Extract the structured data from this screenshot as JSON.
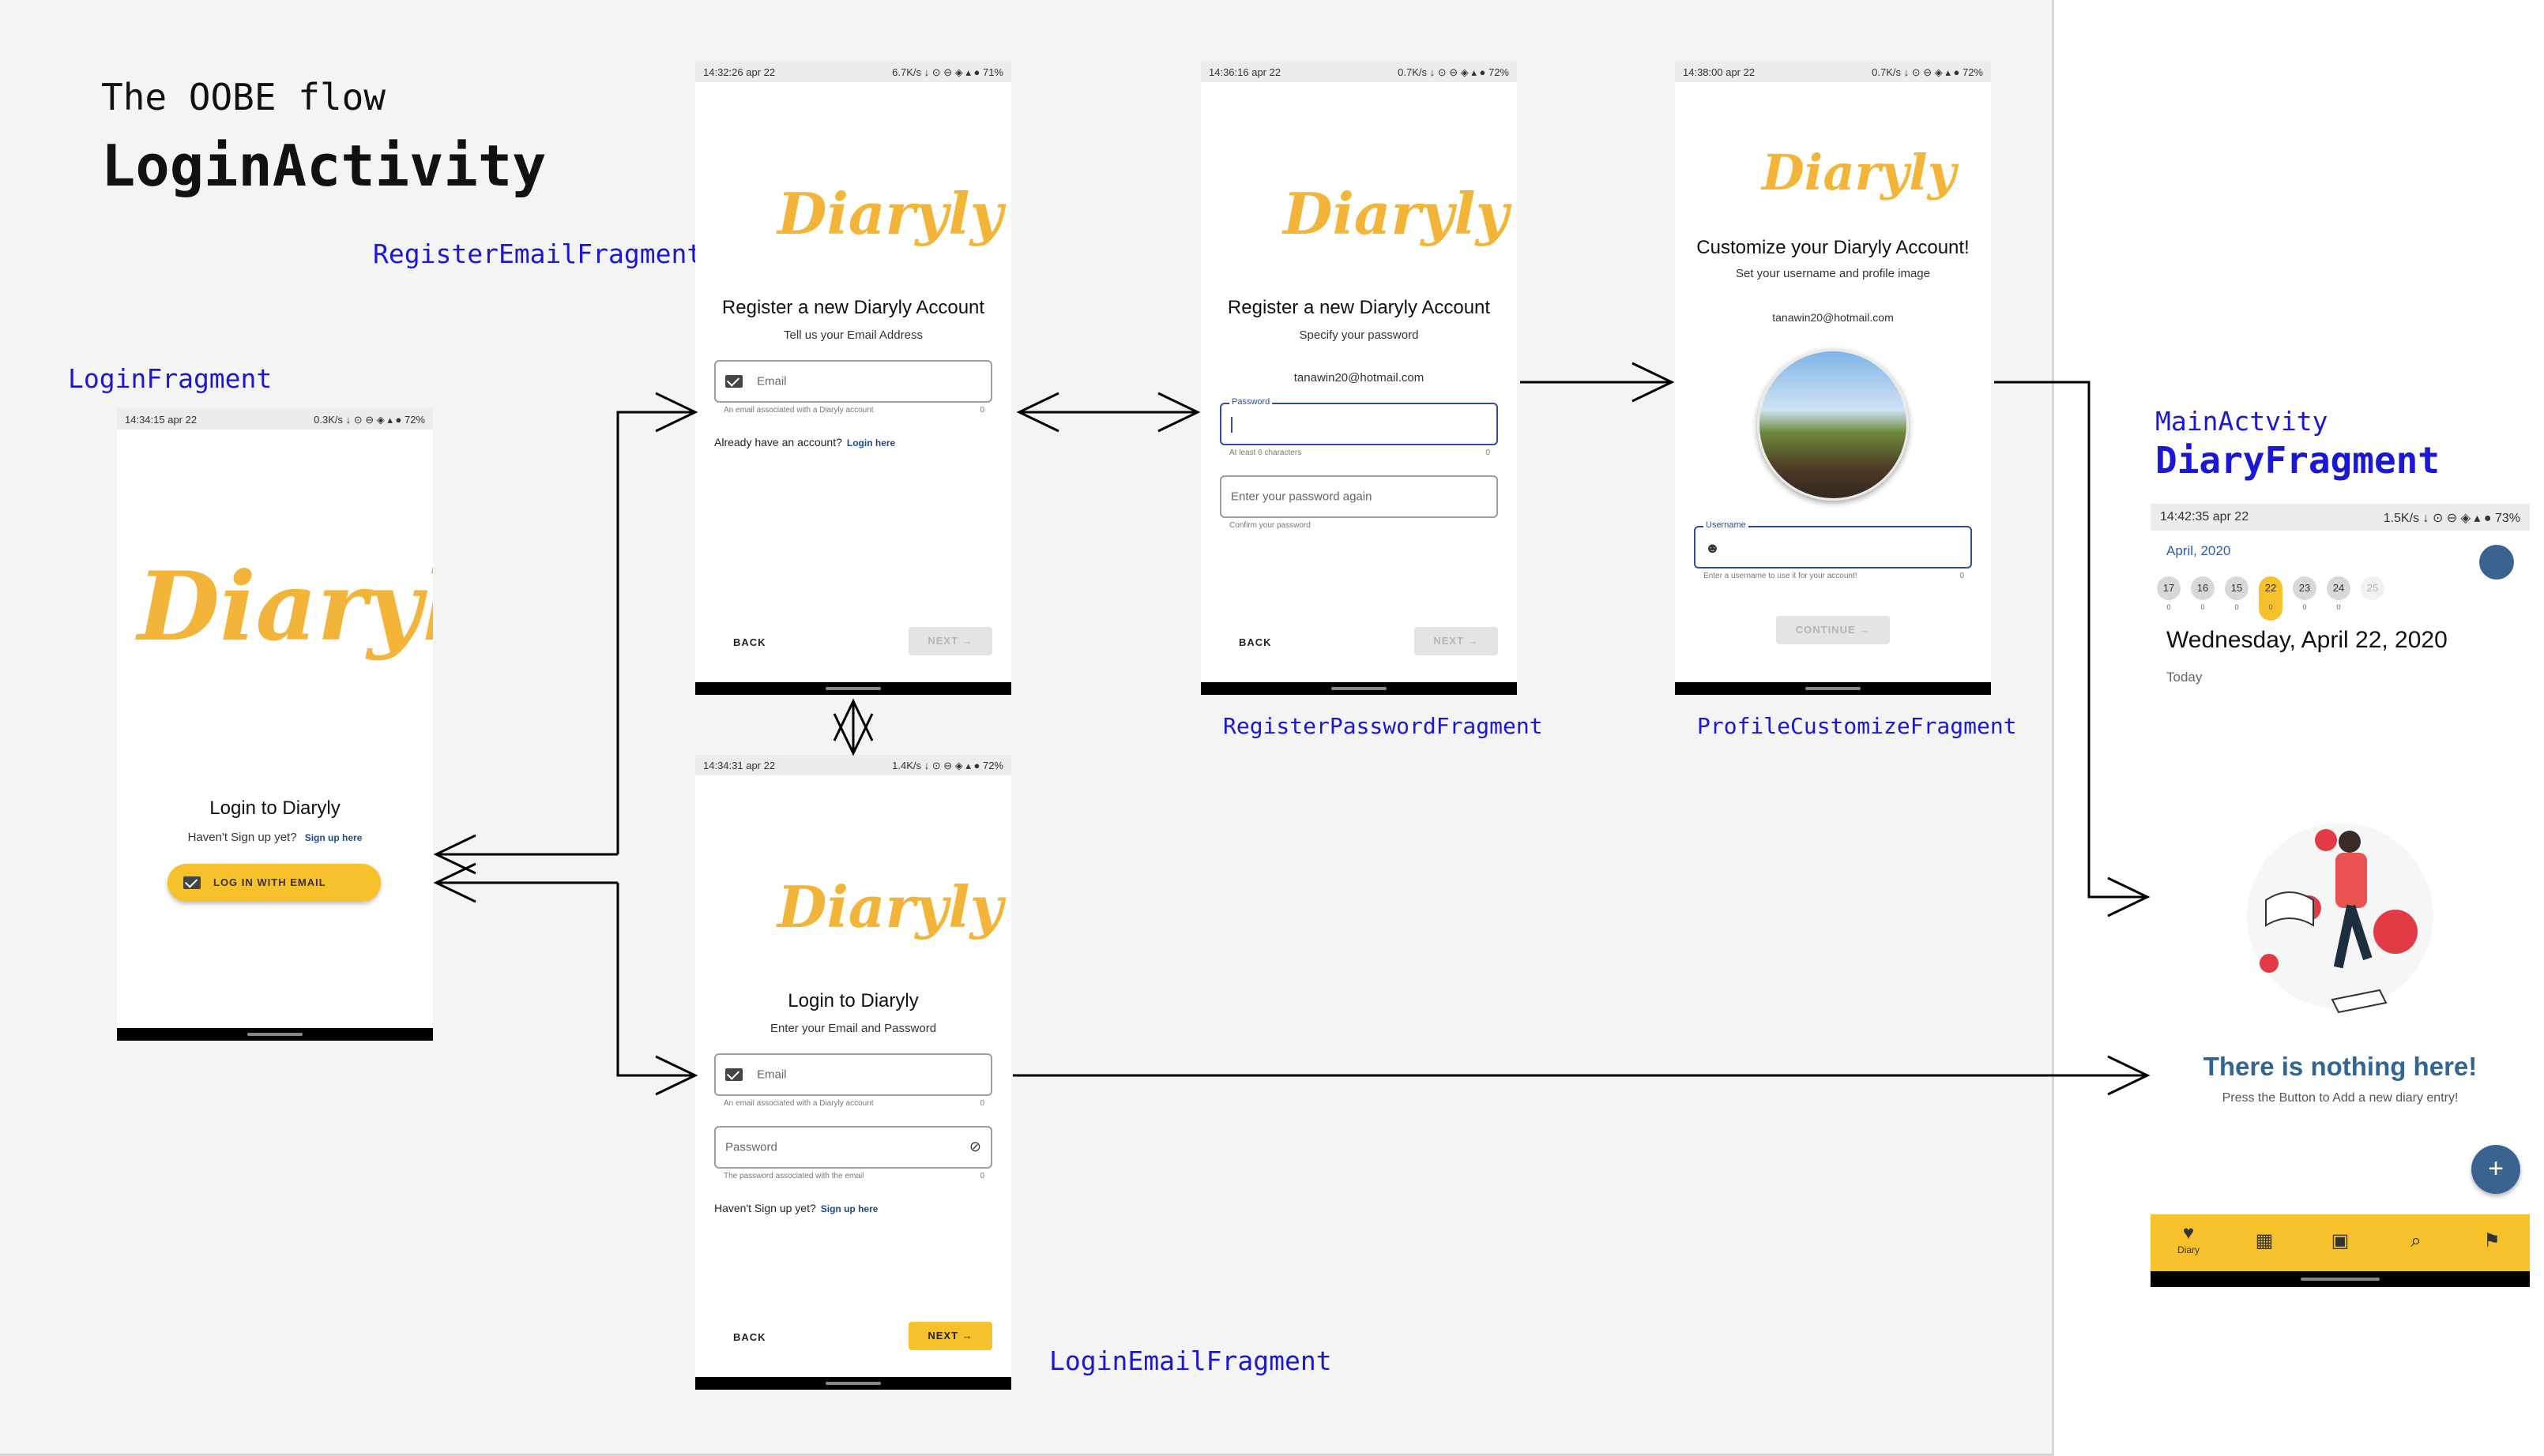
{
  "header": {
    "subtitle": "The OOBE flow",
    "title": "LoginActivity"
  },
  "labels": {
    "login_fragment": "LoginFragment",
    "register_email_fragment": "RegisterEmailFragment",
    "register_password_fragment": "RegisterPasswordFragment",
    "profile_customize_fragment": "ProfileCustomizeFragment",
    "login_email_fragment": "LoginEmailFragment",
    "main_activity": "MainActvity",
    "diary_fragment": "DiaryFragment"
  },
  "brand": {
    "logo_text": "Diaryly",
    "accent": "#f7c12b",
    "link": "#1d4a8a",
    "label_blue": "#1a17d6"
  },
  "screens": {
    "login": {
      "status_time": "14:34:15 apr 22",
      "status_right": "0.3K/s ↓ ⊙ ⊖ ◈ ▴ ● 72%",
      "title": "Login to Diaryly",
      "prompt": "Haven't Sign up yet?",
      "link": "Sign up here",
      "button": "LOG IN WITH EMAIL"
    },
    "register_email": {
      "status_time": "14:32:26 apr 22",
      "status_right": "6.7K/s ↓ ⊙ ⊖ ◈ ▴ ● 71%",
      "title": "Register a new Diaryly Account",
      "subtitle": "Tell us your Email Address",
      "email_placeholder": "Email",
      "email_helper": "An email associated with a Diaryly account",
      "counter": "0",
      "prompt": "Already have an account?",
      "link": "Login here",
      "back": "BACK",
      "next": "NEXT"
    },
    "register_password": {
      "status_time": "14:36:16 apr 22",
      "status_right": "0.7K/s ↓ ⊙ ⊖ ◈ ▴ ● 72%",
      "title": "Register a new Diaryly Account",
      "subtitle": "Specify your password",
      "email": "tanawin20@hotmail.com",
      "password_label": "Password",
      "password_helper": "At least 6 characters",
      "counter": "0",
      "confirm_placeholder": "Enter your password again",
      "confirm_helper": "Confirm your password",
      "back": "BACK",
      "next": "NEXT"
    },
    "profile": {
      "status_time": "14:38:00 apr 22",
      "status_right": "0.7K/s ↓ ⊙ ⊖ ◈ ▴ ● 72%",
      "title": "Customize your Diaryly Account!",
      "subtitle": "Set your username and profile image",
      "email": "tanawin20@hotmail.com",
      "username_label": "Username",
      "username_helper": "Enter a username to use it for your account!",
      "counter": "0",
      "continue": "CONTINUE"
    },
    "login_email": {
      "status_time": "14:34:31 apr 22",
      "status_right": "1.4K/s ↓ ⊙ ⊖ ◈ ▴ ● 72%",
      "title": "Login to Diaryly",
      "subtitle": "Enter your Email and Password",
      "email_placeholder": "Email",
      "email_helper": "An email associated with a Diaryly account",
      "password_placeholder": "Password",
      "password_helper": "The password associated with the email",
      "counter": "0",
      "prompt": "Haven't Sign up yet?",
      "link": "Sign up here",
      "back": "BACK",
      "next": "NEXT"
    },
    "diary": {
      "status_time": "14:42:35 apr 22",
      "status_right": "1.5K/s ↓ ⊙ ⊖ ◈ ▴ ● 73%",
      "month": "April, 2020",
      "days": [
        {
          "num": "17",
          "count": "0"
        },
        {
          "num": "16",
          "count": "0"
        },
        {
          "num": "15",
          "count": "0"
        },
        {
          "num": "22",
          "count": "0"
        },
        {
          "num": "23",
          "count": "0"
        },
        {
          "num": "24",
          "count": "0"
        },
        {
          "num": "25",
          "count": ""
        }
      ],
      "date": "Wednesday, April 22, 2020",
      "today": "Today",
      "empty_title": "There is nothing here!",
      "empty_sub": "Press the Button to Add a new diary entry!",
      "fab": "+",
      "nav": [
        {
          "icon": "heart-icon",
          "label": "Diary"
        },
        {
          "icon": "dashboard-icon",
          "label": ""
        },
        {
          "icon": "calendar-icon",
          "label": ""
        },
        {
          "icon": "search-icon",
          "label": ""
        },
        {
          "icon": "flag-icon",
          "label": ""
        }
      ]
    }
  }
}
